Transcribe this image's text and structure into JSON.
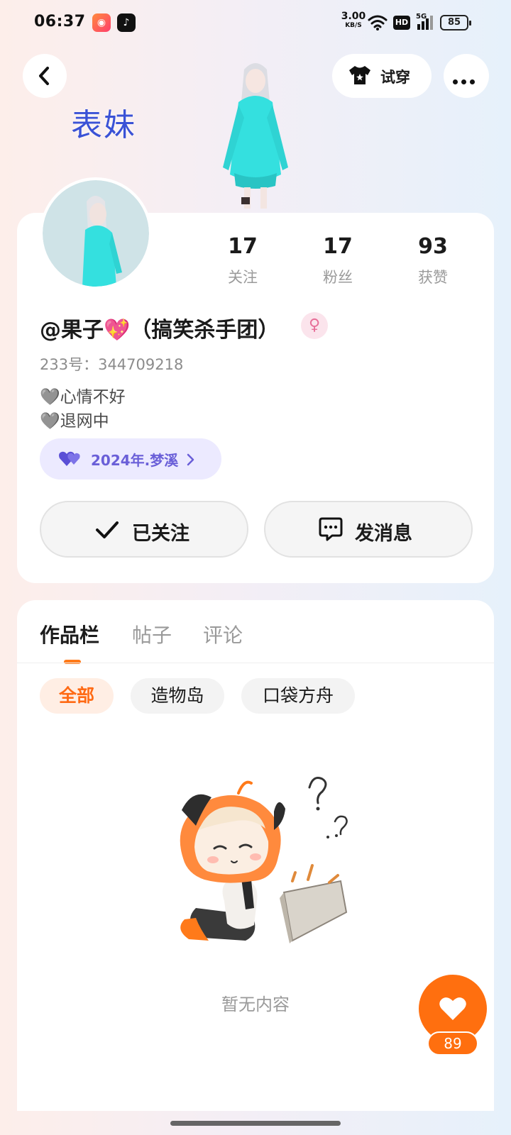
{
  "status_bar": {
    "time": "06:37",
    "net_speed_value": "3.00",
    "net_speed_unit": "KB/S",
    "hd_label": "HD",
    "signal_label": "5G",
    "battery": "85",
    "app_icons": [
      "kuaishou-icon",
      "tiktok-icon"
    ]
  },
  "header": {
    "tryon_label": "试穿",
    "banner_text": "表妹"
  },
  "profile": {
    "stats": [
      {
        "value": "17",
        "label": "关注"
      },
      {
        "value": "17",
        "label": "粉丝"
      },
      {
        "value": "93",
        "label": "获赞"
      }
    ],
    "username": "@果子💖（搞笑杀手团）",
    "gender_symbol": "♀",
    "uid": "233号：344709218",
    "bio_lines": [
      "🩶心情不好",
      "🩶退网中"
    ],
    "tag": "2024年.梦溪",
    "follow_label": "已关注",
    "message_label": "发消息"
  },
  "works": {
    "tabs": [
      "作品栏",
      "帖子",
      "评论"
    ],
    "active_tab": "作品栏",
    "chips": [
      "全部",
      "造物岛",
      "口袋方舟"
    ],
    "active_chip": "全部",
    "empty_text": "暂无内容"
  },
  "like_fab": {
    "count": "89"
  },
  "colors": {
    "accent": "#ff6f0f",
    "tag_bg": "#eceaff",
    "tag_text": "#6a5fd8",
    "banner_text": "#3a52d6"
  }
}
